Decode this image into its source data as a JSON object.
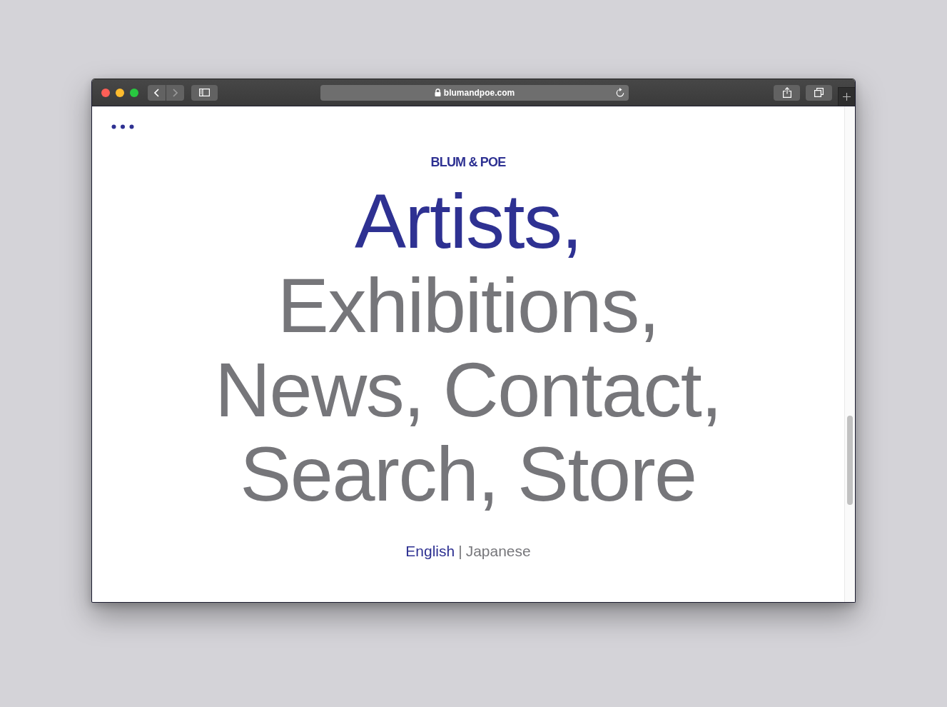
{
  "browser": {
    "nav_buttons": [
      {
        "kind": "back",
        "disabled": false
      },
      {
        "kind": "forward",
        "disabled": true
      }
    ],
    "url": "blumandpoe.com"
  },
  "site": {
    "brand": "BLUM & POE",
    "nav_lines": [
      {
        "items": [
          {
            "label": "Artists,",
            "selected": true
          }
        ]
      },
      {
        "items": [
          {
            "label": "Exhibitions,",
            "selected": false
          }
        ]
      },
      {
        "items": [
          {
            "label": "News,",
            "selected": false
          },
          {
            "label": "Contact,",
            "selected": false
          }
        ]
      },
      {
        "items": [
          {
            "label": "Search,",
            "selected": false
          },
          {
            "label": "Store",
            "selected": false
          }
        ]
      }
    ],
    "languages": [
      {
        "label": "English",
        "selected": true
      },
      {
        "label": "Japanese",
        "selected": false
      }
    ],
    "language_separator": "|"
  }
}
